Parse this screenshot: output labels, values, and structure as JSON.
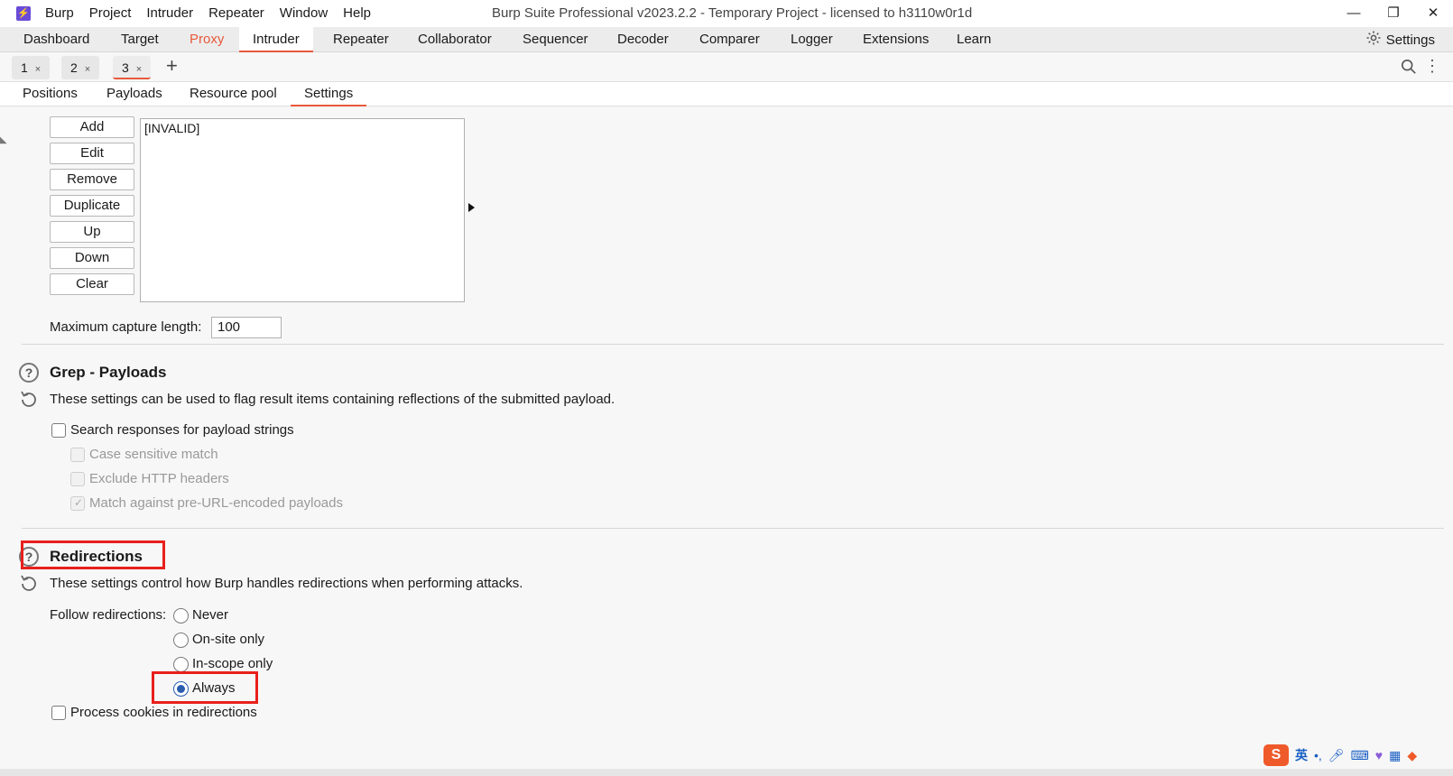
{
  "app": {
    "menu": [
      "Burp",
      "Project",
      "Intruder",
      "Repeater",
      "Window",
      "Help"
    ],
    "title": "Burp Suite Professional v2023.2.2 - Temporary Project - licensed to h3110w0r1d"
  },
  "main_tabs": [
    "Dashboard",
    "Target",
    "Proxy",
    "Intruder",
    "Repeater",
    "Collaborator",
    "Sequencer",
    "Decoder",
    "Comparer",
    "Logger",
    "Extensions",
    "Learn"
  ],
  "settings_label": "Settings",
  "attack_tabs": [
    {
      "label": "1",
      "close": "×"
    },
    {
      "label": "2",
      "close": "×"
    },
    {
      "label": "3",
      "close": "×"
    }
  ],
  "add_tab": "+",
  "intruder_tabs": [
    "Positions",
    "Payloads",
    "Resource pool",
    "Settings"
  ],
  "extract_grep": {
    "buttons": [
      "Add",
      "Edit",
      "Remove",
      "Duplicate",
      "Up",
      "Down",
      "Clear"
    ],
    "list_items": [
      "[INVALID]"
    ],
    "max_capture_label": "Maximum capture length:",
    "max_capture_value": "100"
  },
  "grep_payloads": {
    "title": "Grep - Payloads",
    "description": "These settings can be used to flag result items containing reflections of the submitted payload.",
    "search_label": "Search responses for payload strings",
    "case_label": "Case sensitive match",
    "exclude_label": "Exclude HTTP headers",
    "match_label": "Match against pre-URL-encoded payloads"
  },
  "redirections": {
    "title": "Redirections",
    "description": "These settings control how Burp handles redirections when performing attacks.",
    "follow_label": "Follow redirections:",
    "options": [
      "Never",
      "On-site only",
      "In-scope only",
      "Always"
    ],
    "selected": "Always",
    "process_cookies_label": "Process cookies in redirections"
  },
  "ime": {
    "logo": "S",
    "lang": "英"
  },
  "colors": {
    "accent": "#e8593a",
    "highlight": "#e8201c",
    "radio": "#2a5db0"
  }
}
